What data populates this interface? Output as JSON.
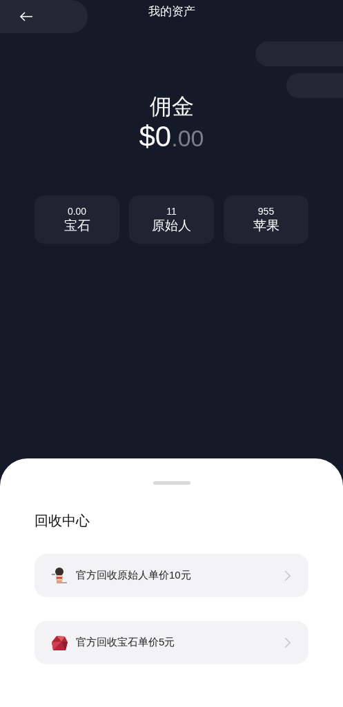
{
  "header": {
    "title": "我的资产"
  },
  "commission": {
    "label": "佣金",
    "amount_main": "$0",
    "amount_decimal": ".00"
  },
  "assets": [
    {
      "value": "0.00",
      "label": "宝石"
    },
    {
      "value": "11",
      "label": "原始人"
    },
    {
      "value": "955",
      "label": "苹果"
    }
  ],
  "recycle_center": {
    "title": "回收中心",
    "items": [
      {
        "kind": "figure",
        "text": "官方回收原始人单价10元"
      },
      {
        "kind": "gem",
        "text": "官方回收宝石单价5元"
      }
    ]
  }
}
